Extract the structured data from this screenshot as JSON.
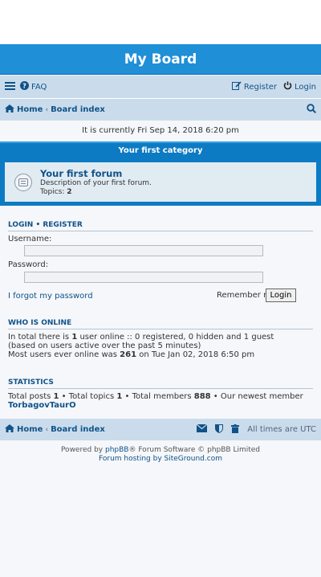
{
  "header": {
    "title": "My Board"
  },
  "nav": {
    "faq": "FAQ",
    "register": "Register",
    "login": "Login"
  },
  "breadcrumb": {
    "home": "Home",
    "board_index": "Board index"
  },
  "datetime": "It is currently Fri Sep 14, 2018 6:20 pm",
  "category": {
    "title": "Your first category"
  },
  "forum": {
    "title": "Your first forum",
    "description": "Description of your first forum.",
    "topics_label": "Topics:",
    "topics_count": "2"
  },
  "login": {
    "section_title": "LOGIN • REGISTER",
    "username_label": "Username:",
    "password_label": "Password:",
    "forgot": "I forgot my password",
    "remember": "Remember me",
    "button": "Login"
  },
  "online": {
    "section_title": "WHO IS ONLINE",
    "line1_pre": "In total there is ",
    "line1_count": "1",
    "line1_post": " user online :: 0 registered, 0 hidden and 1 guest",
    "line2": "(based on users active over the past 5 minutes)",
    "line3_pre": "Most users ever online was ",
    "line3_count": "261",
    "line3_post": " on Tue Jan 02, 2018 6:50 pm"
  },
  "stats": {
    "section_title": "STATISTICS",
    "posts_label": "Total posts ",
    "posts": "1",
    "topics_label": " • Total topics ",
    "topics": "1",
    "members_label": " • Total members ",
    "members": "888",
    "newest_label": " • Our newest member ",
    "newest": "TorbagovTaurO"
  },
  "footer": {
    "timezone": "All times are UTC",
    "powered_pre": "Powered by ",
    "phpbb": "phpBB",
    "powered_post": "® Forum Software © phpBB Limited",
    "hosting": "Forum hosting by SiteGround.com"
  },
  "colors": {
    "header_blue": "#1f8fd7",
    "nav_bg": "#cadceb",
    "link": "#105289"
  }
}
